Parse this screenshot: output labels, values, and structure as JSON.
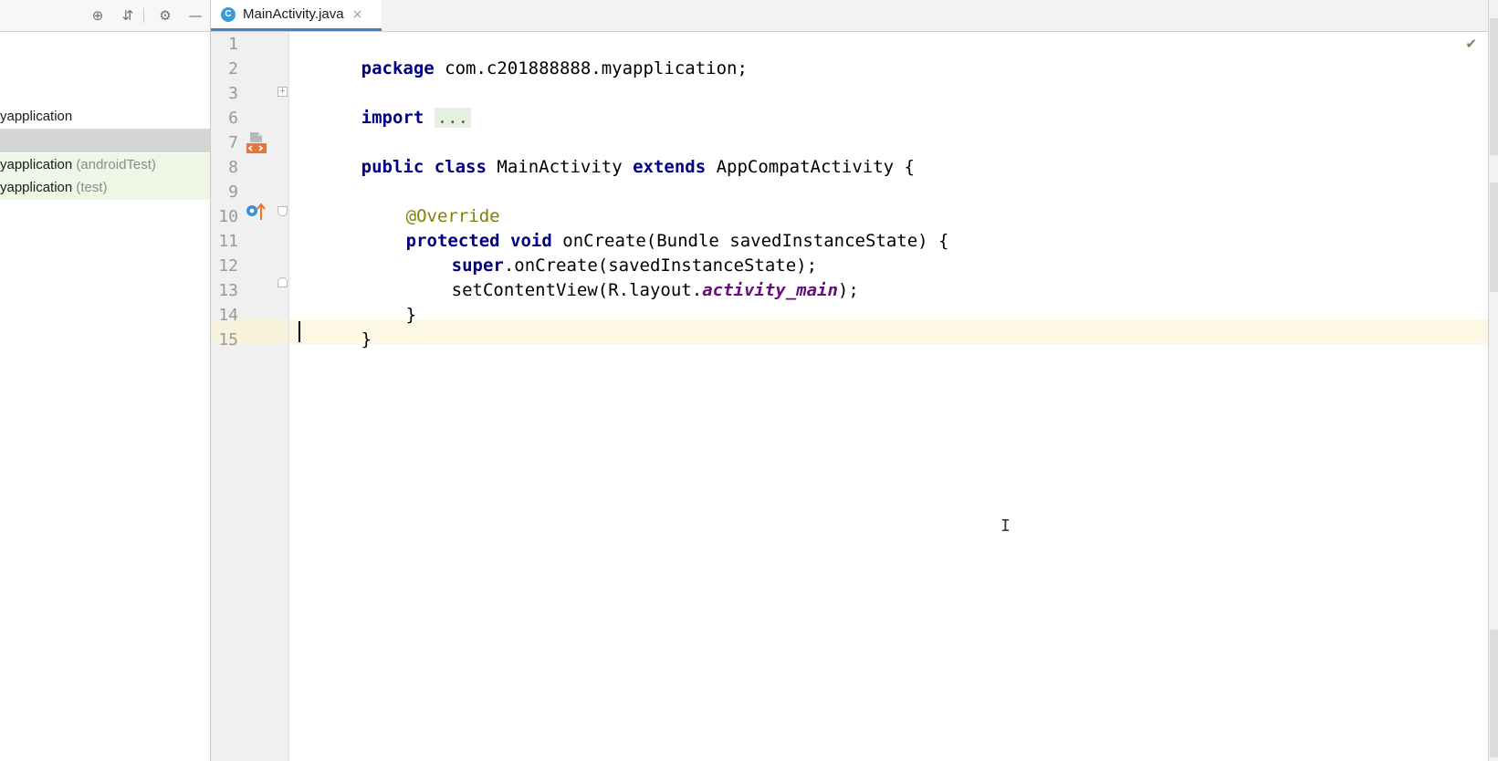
{
  "project_panel": {
    "toolbar": {
      "locate_icon": "⊕",
      "collapse_icon": "⇵",
      "settings_icon": "⚙",
      "hide_icon": "—"
    },
    "tree": [
      {
        "label": "yapplication",
        "suffix": ""
      },
      {
        "label": "",
        "suffix": ""
      },
      {
        "label": "yapplication",
        "suffix": " (androidTest)"
      },
      {
        "label": "yapplication",
        "suffix": " (test)"
      }
    ]
  },
  "editor": {
    "tab": {
      "file_icon_letter": "C",
      "title": "MainActivity.java",
      "close_icon": "×"
    },
    "line_numbers": [
      "1",
      "2",
      "3",
      "6",
      "7",
      "8",
      "9",
      "10",
      "11",
      "12",
      "13",
      "14",
      "15"
    ],
    "code": {
      "l1_kw": "package",
      "l1_rest": " com.c201888888.myapplication;",
      "l3_kw": "import",
      "l3_folded": "...",
      "l7_kw1": "public",
      "l7_kw2": "class",
      "l7_name": " MainActivity ",
      "l7_kw3": "extends",
      "l7_rest": " AppCompatActivity {",
      "l9_anno": "@Override",
      "l10_kw1": "protected",
      "l10_kw2": "void",
      "l10_rest": " onCreate(Bundle savedInstanceState) {",
      "l11_kw": "super",
      "l11_rest": ".onCreate(savedInstanceState);",
      "l12_pre": "setContentView(R.layout.",
      "l12_field": "activity_main",
      "l12_post": ");",
      "l13": "}",
      "l14": "}"
    },
    "inspection_icon": "✔",
    "text_cursor_glyph": "I"
  }
}
